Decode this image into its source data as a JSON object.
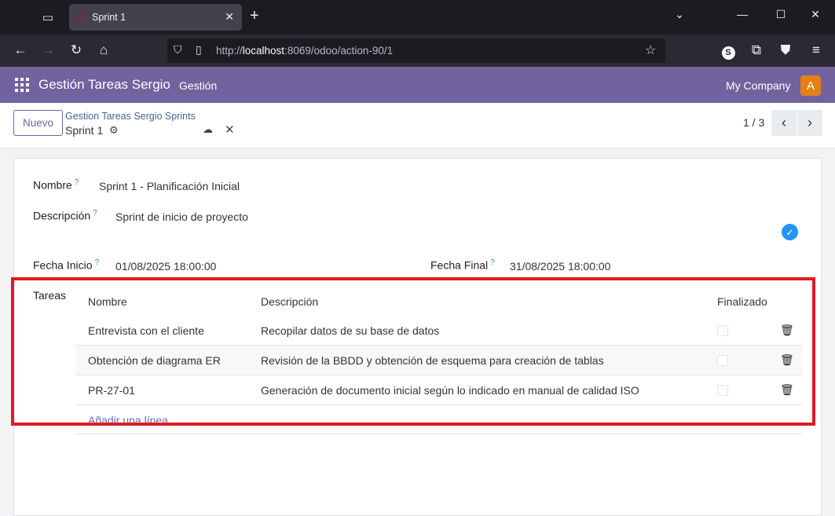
{
  "browser": {
    "tab_title": "Sprint 1",
    "url_prefix": "http://",
    "url_host": "localhost",
    "url_rest": ":8069/odoo/action-90/1"
  },
  "app": {
    "title": "Gestión Tareas Sergio",
    "menu": "Gestión",
    "company": "My Company",
    "avatar_letter": "A"
  },
  "control": {
    "new_label": "Nuevo",
    "breadcrumb_parent": "Gestion Tareas Sergio Sprints",
    "breadcrumb_current": "Sprint 1",
    "pager": "1 / 3"
  },
  "form": {
    "nombre_label": "Nombre",
    "nombre_value": "Sprint 1 - Planificación Inicial",
    "descripcion_label": "Descripción",
    "descripcion_value": "Sprint de inicio de proyecto",
    "fecha_inicio_label": "Fecha Inicio",
    "fecha_inicio_value": "01/08/2025 18:00:00",
    "fecha_final_label": "Fecha Final",
    "fecha_final_value": "31/08/2025 18:00:00",
    "help_mark": "?",
    "tareas_label": "Tareas"
  },
  "tasks": {
    "columns": [
      "Nombre",
      "Descripción",
      "Finalizado"
    ],
    "rows": [
      {
        "nombre": "Entrevista con el cliente",
        "descripcion": "Recopilar datos de su base de datos",
        "finalizado": false
      },
      {
        "nombre": "Obtención de diagrama ER",
        "descripcion": "Revisión de la BBDD y obtención de esquema para creación de tablas",
        "finalizado": false
      },
      {
        "nombre": "PR-27-01",
        "descripcion": "Generación de documento inicial según lo indicado en manual de calidad ISO",
        "finalizado": false
      }
    ],
    "add_line": "Añadir una línea"
  },
  "colors": {
    "brand": "#71639e",
    "highlight": "#e01b24",
    "avatar": "#e57f16"
  }
}
